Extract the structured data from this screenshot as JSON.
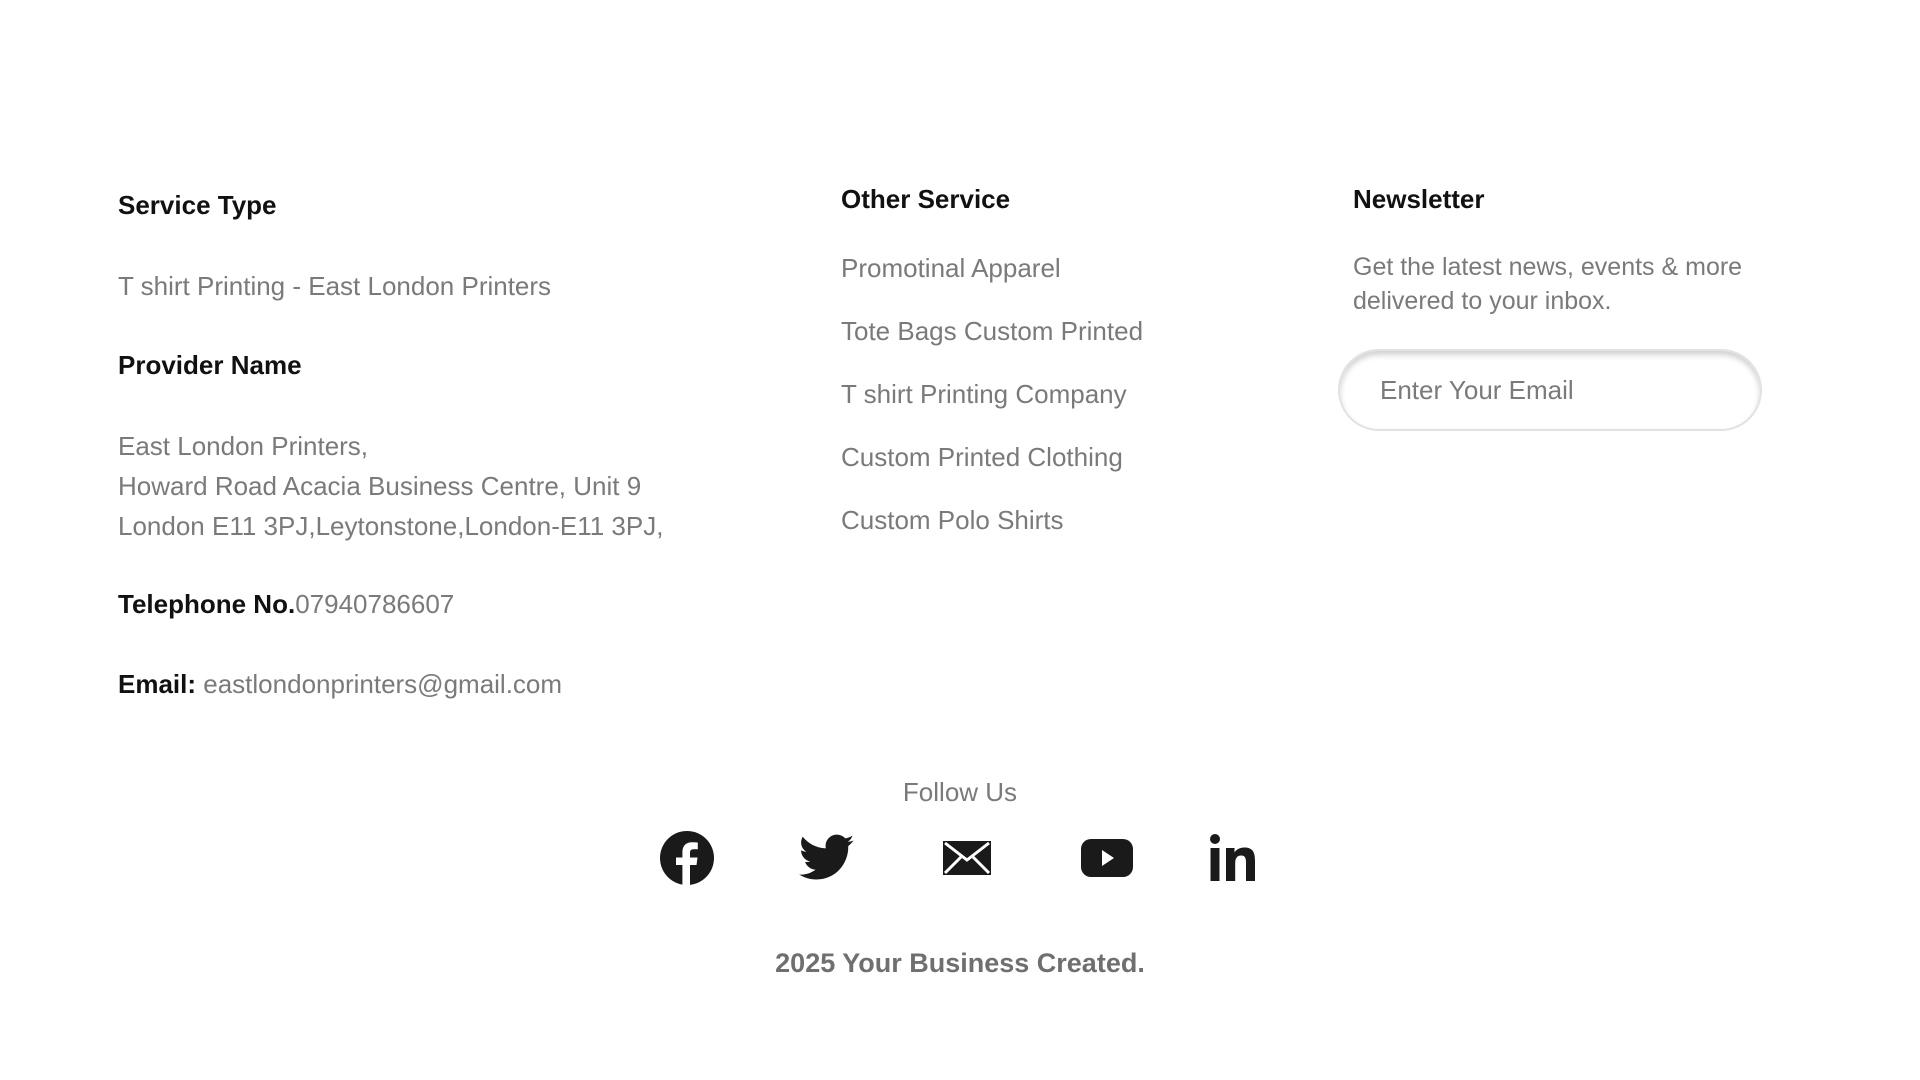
{
  "service": {
    "heading": "Service Type",
    "value": "T shirt Printing - East London Printers"
  },
  "provider": {
    "heading": "Provider Name",
    "address_lines": [
      "East London Printers,",
      "Howard Road Acacia Business Centre, Unit 9",
      "London E11 3PJ,Leytonstone,London-E11 3PJ,"
    ]
  },
  "phone": {
    "label": "Telephone No.",
    "value": "07940786607"
  },
  "email": {
    "label": "Email:",
    "value": "eastlondonprinters@gmail.com"
  },
  "other_service": {
    "heading": "Other Service",
    "items": [
      "Promotinal Apparel",
      "Tote Bags Custom Printed",
      "T shirt Printing Company",
      "Custom Printed Clothing",
      "Custom Polo Shirts"
    ]
  },
  "newsletter": {
    "heading": "Newsletter",
    "description": "Get the latest news, events & more delivered to your inbox.",
    "input_placeholder": "Enter Your Email"
  },
  "social": {
    "title": "Follow Us",
    "icons": [
      "facebook-icon",
      "twitter-icon",
      "mail-icon",
      "youtube-icon",
      "linkedin-icon"
    ],
    "icon_color": "#1a1a1a"
  },
  "footer": {
    "copyright": "2025 Your Business Created."
  }
}
